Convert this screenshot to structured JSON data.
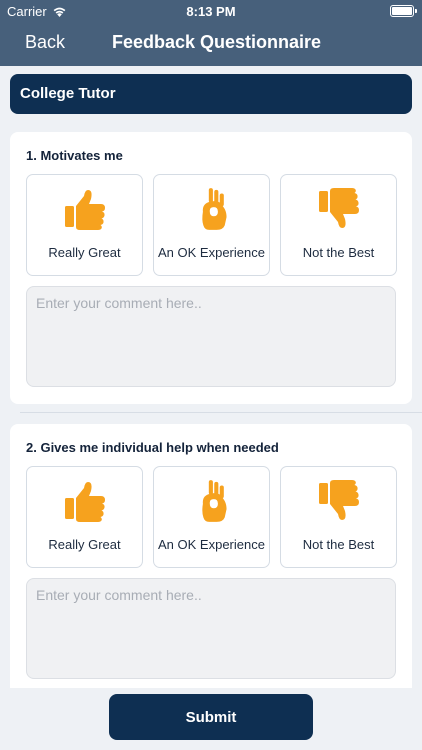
{
  "status_bar": {
    "carrier": "Carrier",
    "time": "8:13 PM"
  },
  "nav": {
    "back_label": "Back",
    "title": "Feedback Questionnaire"
  },
  "tutor": {
    "name": "College Tutor"
  },
  "questions": [
    {
      "text": "1. Motivates me",
      "options": [
        {
          "label": "Really Great",
          "icon": "thumbs-up-icon"
        },
        {
          "label": "An OK Experience",
          "icon": "ok-hand-icon"
        },
        {
          "label": "Not the Best",
          "icon": "thumbs-down-icon"
        }
      ],
      "comment_placeholder": "Enter your comment here..",
      "comment_value": ""
    },
    {
      "text": "2. Gives me individual help when needed",
      "options": [
        {
          "label": "Really Great",
          "icon": "thumbs-up-icon"
        },
        {
          "label": "An OK Experience",
          "icon": "ok-hand-icon"
        },
        {
          "label": "Not the Best",
          "icon": "thumbs-down-icon"
        }
      ],
      "comment_placeholder": "Enter your comment here..",
      "comment_value": ""
    }
  ],
  "submit_label": "Submit",
  "colors": {
    "nav_background": "#47607b",
    "primary_dark": "#0e2f52",
    "icon_orange": "#f6a21e",
    "page_background": "#eef1f5"
  }
}
